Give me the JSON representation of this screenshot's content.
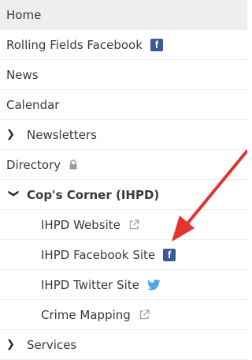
{
  "menu": {
    "items": [
      {
        "label": "Home"
      },
      {
        "label": "Rolling Fields Facebook"
      },
      {
        "label": "News"
      },
      {
        "label": "Calendar"
      },
      {
        "label": "Newsletters"
      },
      {
        "label": "Directory"
      },
      {
        "label": "Cop's Corner (IHPD)"
      },
      {
        "label": "IHPD Website"
      },
      {
        "label": "IHPD Facebook Site"
      },
      {
        "label": "IHPD Twitter Site"
      },
      {
        "label": "Crime Mapping"
      },
      {
        "label": "Services"
      }
    ]
  },
  "icons": {
    "facebook_glyph": "f",
    "chevron_right": "❯",
    "chevron_down": "❯"
  },
  "colors": {
    "facebook": "#3b5998",
    "twitter": "#4da6e8",
    "arrow": "#e0342f"
  }
}
